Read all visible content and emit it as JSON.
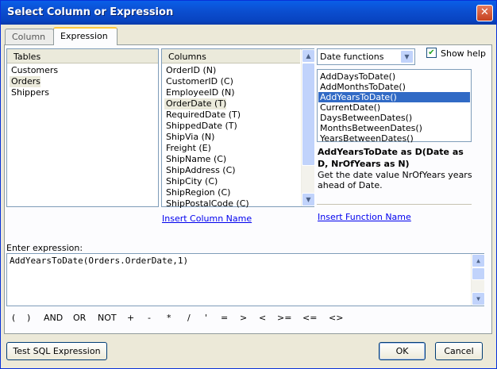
{
  "window": {
    "title": "Select Column or Expression",
    "close_glyph": "✕"
  },
  "tabs": [
    {
      "label": "Column"
    },
    {
      "label": "Expression"
    }
  ],
  "tables": {
    "header": "Tables",
    "items": [
      "Customers",
      "Orders",
      "Shippers"
    ],
    "selected": "Orders"
  },
  "columns": {
    "header": "Columns",
    "items": [
      "OrderID (N)",
      "CustomerID (C)",
      "EmployeeID (N)",
      "OrderDate (T)",
      "RequiredDate (T)",
      "ShippedDate (T)",
      "ShipVia (N)",
      "Freight (E)",
      "ShipName (C)",
      "ShipAddress (C)",
      "ShipCity (C)",
      "ShipRegion (C)",
      "ShipPostalCode (C)"
    ],
    "selected": "OrderDate (T)"
  },
  "insert_column_link": "Insert Column Name",
  "function_category": {
    "value": "Date functions"
  },
  "show_help": {
    "label": "Show help",
    "checked": true
  },
  "functions": {
    "items": [
      "AddDaysToDate()",
      "AddMonthsToDate()",
      "AddYearsToDate()",
      "CurrentDate()",
      "DaysBetweenDates()",
      "MonthsBetweenDates()",
      "YearsBetweenDates()"
    ],
    "selected": "AddYearsToDate()"
  },
  "function_help": {
    "signature": "AddYearsToDate as D(Date as D, NrOfYears as N)",
    "description": "Get the date value NrOfYears years ahead of Date."
  },
  "insert_function_link": "Insert Function Name",
  "expression": {
    "label": "Enter expression:",
    "value": "AddYearsToDate(Orders.OrderDate,1)"
  },
  "operators": [
    "(",
    ")",
    "AND",
    "OR",
    "NOT",
    "+",
    "-",
    "*",
    "/",
    "'",
    "=",
    ">",
    "<",
    ">=",
    "<=",
    "<>"
  ],
  "buttons": {
    "test": "Test SQL Expression",
    "ok": "OK",
    "cancel": "Cancel"
  }
}
